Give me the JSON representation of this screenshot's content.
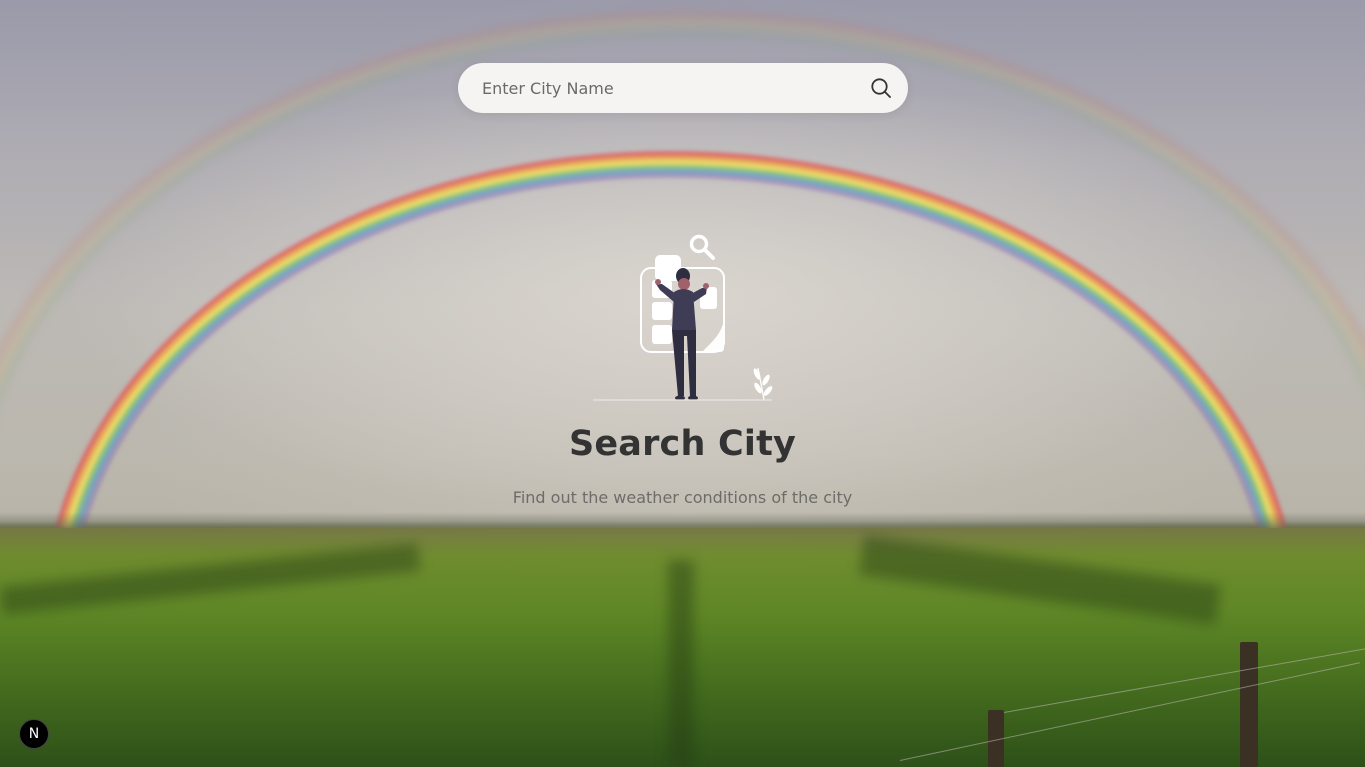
{
  "search": {
    "placeholder": "Enter City Name",
    "value": "",
    "icon": "search-icon"
  },
  "empty_state": {
    "illustration": "person-searching-city-illustration",
    "title": "Search City",
    "subtitle": "Find out the weather conditions of the city"
  },
  "dev_badge": {
    "label": "N",
    "icon": "nextjs-logo-icon"
  },
  "background": {
    "image": "rainbow-over-green-field",
    "colors": {
      "field": "#5f8726",
      "sky": "#c3bfb7"
    }
  }
}
